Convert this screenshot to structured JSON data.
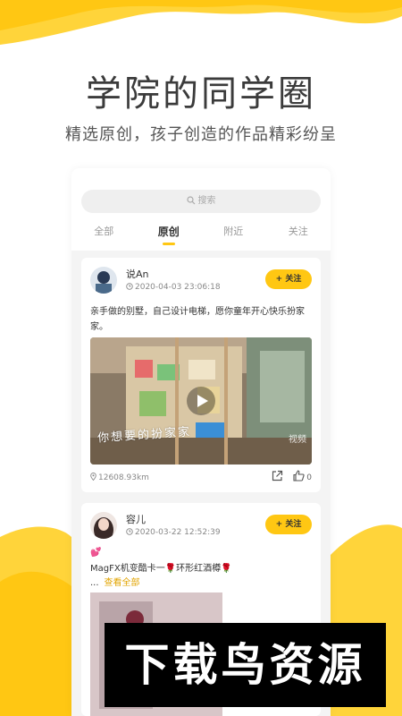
{
  "hero": {
    "title": "学院的同学圈",
    "subtitle": "精选原创，孩子创造的作品精彩纷呈"
  },
  "search": {
    "placeholder": "搜索"
  },
  "tabs": [
    {
      "label": "全部",
      "active": false
    },
    {
      "label": "原创",
      "active": true
    },
    {
      "label": "附近",
      "active": false
    },
    {
      "label": "关注",
      "active": false
    }
  ],
  "posts": [
    {
      "username": "说An",
      "time": "2020-04-03 23:06:18",
      "follow_label": "+ 关注",
      "text": "亲手做的别墅，自己设计电梯，愿你童年开心快乐扮家家。",
      "video_caption": "你想要的扮家家",
      "video_mark": "视频",
      "distance": "12608.93km",
      "likes": "0"
    },
    {
      "username": "容儿",
      "time": "2020-03-22 12:52:39",
      "follow_label": "+ 关注",
      "emoji_line": "💕",
      "text": "MagFX机变酷卡一🌹环形红酒樽🌹",
      "ellipsis": "...",
      "more_label": "查看全部"
    }
  ],
  "watermark": "下载鸟资源",
  "colors": {
    "accent": "#ffc713",
    "more_link": "#e2a400"
  }
}
